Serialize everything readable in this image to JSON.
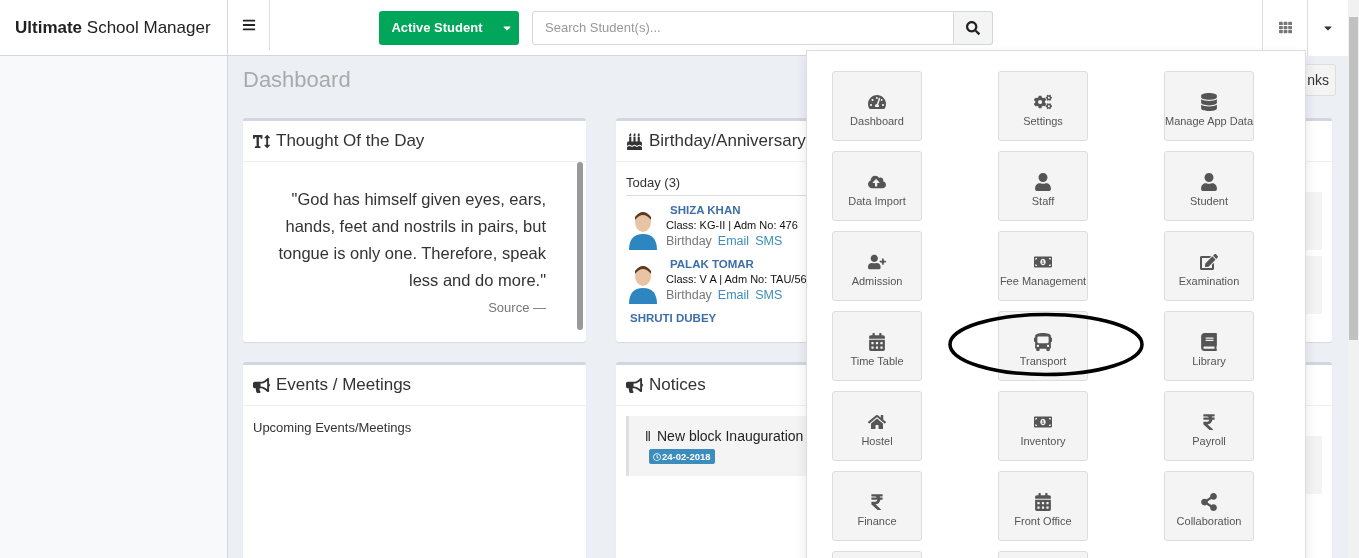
{
  "header": {
    "brand": "**Ultimate** School Manager",
    "student_filter": {
      "label": "Active Student"
    },
    "search": {
      "placeholder": "Search Student(s)..."
    }
  },
  "page": {
    "title": "Dashboard",
    "links_button": "nks"
  },
  "thought": {
    "title": "Thought Of the Day",
    "quote": "\"God has himself given eyes, ears, hands, feet and nostrils in pairs, but tongue is only one. Therefore, speak less and do more.\"",
    "source": "Source —"
  },
  "birthdays": {
    "title": "Birthday/Anniversary",
    "today": "Today (3)",
    "people": [
      {
        "name": "SHIZA KHAN",
        "details": "Class: KG-II | Adm No: 476",
        "occasion": "Birthday",
        "links": [
          "Email",
          "SMS"
        ]
      },
      {
        "name": "PALAK TOMAR",
        "details": "Class: V A | Adm No: TAU/56",
        "occasion": "Birthday",
        "links": [
          "Email",
          "SMS"
        ]
      },
      {
        "name": "SHRUTI DUBEY"
      }
    ]
  },
  "events": {
    "title": "Events / Meetings",
    "subtitle": "Upcoming Events/Meetings"
  },
  "notices": {
    "title": "Notices",
    "items": [
      {
        "title": "New block Inauguration",
        "date": "24-02-2018"
      }
    ]
  },
  "apps_menu": {
    "items": [
      {
        "kind": "tile",
        "label": "Dashboard",
        "highlighted": false
      },
      {
        "kind": "tile",
        "label": "Settings",
        "highlighted": false
      },
      {
        "kind": "tile",
        "label": "Manage App Data",
        "highlighted": false
      },
      {
        "kind": "tile",
        "label": "Data Import",
        "highlighted": false
      },
      {
        "kind": "tile",
        "label": "Staff",
        "highlighted": false
      },
      {
        "kind": "tile",
        "label": "Student",
        "highlighted": false
      },
      {
        "kind": "tile",
        "label": "Admission",
        "highlighted": false
      },
      {
        "kind": "tile",
        "label": "Fee Management",
        "highlighted": false
      },
      {
        "kind": "tile",
        "label": "Examination",
        "highlighted": false
      },
      {
        "kind": "tile",
        "label": "Time Table",
        "highlighted": false
      },
      {
        "kind": "tile",
        "label": "Transport",
        "highlighted": true
      },
      {
        "kind": "tile",
        "label": "Library",
        "highlighted": false
      },
      {
        "kind": "tile",
        "label": "Hostel",
        "highlighted": false
      },
      {
        "kind": "tile",
        "label": "Inventory",
        "highlighted": false
      },
      {
        "kind": "tile",
        "label": "Payroll",
        "highlighted": false
      },
      {
        "kind": "tile",
        "label": "Finance",
        "highlighted": false
      },
      {
        "kind": "tile",
        "label": "Front Office",
        "highlighted": false
      },
      {
        "kind": "tile",
        "label": "Collaboration",
        "highlighted": false
      },
      {
        "kind": "cut"
      },
      {
        "kind": "cut"
      }
    ]
  }
}
